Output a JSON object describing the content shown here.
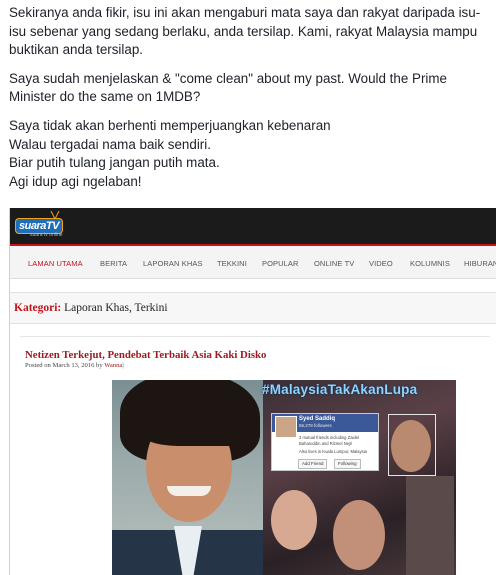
{
  "post": {
    "paragraphs": [
      "Sekiranya anda fikir, isu ini akan mengaburi mata saya dan rakyat daripada isu-isu sebenar yang sedang berlaku, anda tersilap. Kami, rakyat Malaysia mampu buktikan anda tersilap.",
      "Saya sudah menjelaskan & \"come clean\" about my past. Would the Prime Minister do the same on 1MDB?"
    ],
    "lines": [
      "Saya tidak akan berhenti memperjuangkan kebenaran",
      "Walau tergadai nama baik sendiri.",
      "Biar putih tulang jangan putih mata.",
      "Agi idup agi ngelaban!"
    ]
  },
  "site": {
    "logo": "suaraTV",
    "logo_sub": "suara tv online",
    "nav": [
      "LAMAN UTAMA",
      "BERITA",
      "LAPORAN KHAS",
      "TEKKINI",
      "POPULAR",
      "ONLINE TV",
      "VIDEO",
      "KOLUMNIS",
      "HIBURAN"
    ],
    "category_label": "Kategori:",
    "category_value": "Laporan Khas, Terkini",
    "article": {
      "title": "Netizen Terkejut, Pendebat Terbaik Asia Kaki Disko",
      "meta_prefix": "Posted on March 13, 2016 by",
      "author": "Wanna"
    },
    "image": {
      "hashtag": "#MalaysiaTakAkanLupa",
      "fb_name": "Syed Saddiq",
      "fb_followers": "56,278 followers",
      "fb_info_1": "3 mutual friends including Zaidel",
      "fb_info_2": "Baharuddin and Rizmel Nejri",
      "fb_info_3": "Also lives in Kuala Lumpur, Malaysia",
      "fb_add": "Add Friend",
      "fb_follow": "Following"
    }
  },
  "colors": {
    "accent_red": "#c0141a",
    "headline": "#9b1c20",
    "topbar": "#1b1b1b"
  }
}
